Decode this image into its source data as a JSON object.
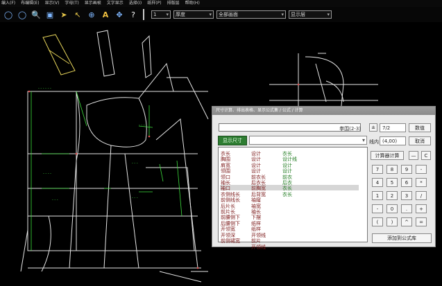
{
  "menu": [
    "编入(F)",
    "布编辑(E)",
    "显示(V)",
    "字母(T)",
    "显示画帧",
    "文字显示",
    "选择(I)",
    "纸样(P)",
    "排版层",
    "帮助(H)"
  ],
  "toolbar": {
    "icons": [
      "new-icon",
      "open-icon",
      "zoom-icon",
      "save-icon",
      "pointer-icon",
      "select-icon",
      "measure-icon",
      "text-icon",
      "move-icon",
      "help-icon"
    ],
    "dropdown_1": "厚度",
    "dropdown_2": "全部画面",
    "dropdown_3": "显示层",
    "number_value": "1"
  },
  "dialog": {
    "title": "尺寸计算、排出表格、显示公式集 / 公式 / 计算",
    "formula_value": "拳围(2-3)",
    "result_value": "7/2",
    "confirm_label": "数值",
    "length_label": "线内",
    "length_value": "(4,00)",
    "cancel_label": "取消",
    "show_dims_label": "显示尺寸",
    "select_formula_label": "计算器计算",
    "add_formula_label": "添加到公式库",
    "list_col1": [
      "衣长",
      "胸围",
      "肩宽",
      "领围",
      "领口",
      "袖长",
      "袖口",
      "衣侧线长",
      "前侧线长",
      "后片长",
      "前片长",
      "前腰侧下",
      "后腰侧下",
      "开领宽",
      "开领深",
      "前侧裙宽"
    ],
    "list_col2": [
      "设计",
      "设计",
      "设计",
      "设计",
      "前衣长",
      "后衣长",
      "前胸宽",
      "后背宽",
      "袖窿",
      "袖宽",
      "袖长",
      "下摆",
      "纸样",
      "纸样",
      "开领线",
      "前片",
      "开领线"
    ],
    "list_col3": [
      "衣长",
      "设计线",
      "设计",
      "设计",
      "前衣",
      "后衣",
      "衣长",
      "衣长"
    ],
    "keys": [
      "7",
      "8",
      "9",
      "-",
      "4",
      "5",
      "6",
      "*",
      "1",
      "2",
      "3",
      "/",
      "-",
      "0",
      ".",
      "+",
      "(",
      ")",
      "^",
      "="
    ]
  }
}
